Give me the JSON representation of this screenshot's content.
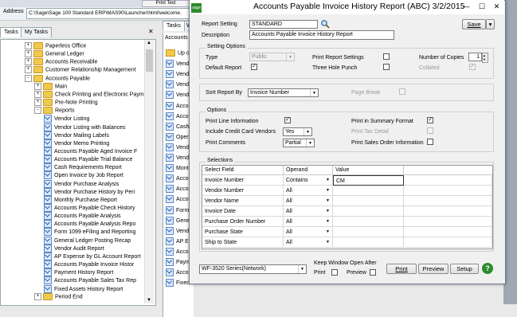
{
  "explorer": {
    "top_tab": "Print Test",
    "address_label": "Address",
    "address_value": "C:\\Sage\\Sage 100 Standard ERP\\MAS90\\Launcher\\html\\welcome.",
    "tabs": [
      "Tasks",
      "My Tasks"
    ],
    "tree": [
      {
        "label": "Paperless Office",
        "indent": 0,
        "exp": "+",
        "type": "folder"
      },
      {
        "label": "General Ledger",
        "indent": 0,
        "exp": "+",
        "type": "folder"
      },
      {
        "label": "Accounts Receivable",
        "indent": 0,
        "exp": "+",
        "type": "folder"
      },
      {
        "label": "Customer Relationship Management",
        "indent": 0,
        "exp": "+",
        "type": "folder"
      },
      {
        "label": "Accounts Payable",
        "indent": 0,
        "exp": "-",
        "type": "folder"
      },
      {
        "label": "Main",
        "indent": 1,
        "exp": "+",
        "type": "folder"
      },
      {
        "label": "Check Printing and Electronic Paymer",
        "indent": 1,
        "exp": "+",
        "type": "folder"
      },
      {
        "label": "Pre-Note Printing",
        "indent": 1,
        "exp": "+",
        "type": "folder"
      },
      {
        "label": "Reports",
        "indent": 1,
        "exp": "-",
        "type": "folder"
      },
      {
        "label": "Vendor Listing",
        "indent": 2,
        "exp": "",
        "type": "task"
      },
      {
        "label": "Vendor Listing with Balances",
        "indent": 2,
        "exp": "",
        "type": "task"
      },
      {
        "label": "Vendor Mailing Labels",
        "indent": 2,
        "exp": "",
        "type": "task"
      },
      {
        "label": "Vendor Memo Printing",
        "indent": 2,
        "exp": "",
        "type": "task"
      },
      {
        "label": "Accounts Payable Aged Invoice F",
        "indent": 2,
        "exp": "",
        "type": "task"
      },
      {
        "label": "Accounts Payable Trial Balance",
        "indent": 2,
        "exp": "",
        "type": "task"
      },
      {
        "label": "Cash Requirements Report",
        "indent": 2,
        "exp": "",
        "type": "task"
      },
      {
        "label": "Open Invoice by Job Report",
        "indent": 2,
        "exp": "",
        "type": "task"
      },
      {
        "label": "Vendor Purchase Analysis",
        "indent": 2,
        "exp": "",
        "type": "task"
      },
      {
        "label": "Vendor Purchase History by Peri",
        "indent": 2,
        "exp": "",
        "type": "task"
      },
      {
        "label": "Monthly Purchase Report",
        "indent": 2,
        "exp": "",
        "type": "task"
      },
      {
        "label": "Accounts Payable Check History",
        "indent": 2,
        "exp": "",
        "type": "task"
      },
      {
        "label": "Accounts Payable Analysis",
        "indent": 2,
        "exp": "",
        "type": "task"
      },
      {
        "label": "Accounts Payable Analysis Repo",
        "indent": 2,
        "exp": "",
        "type": "task"
      },
      {
        "label": "Form 1099 eFiling and Reporting",
        "indent": 2,
        "exp": "",
        "type": "task"
      },
      {
        "label": "General Ledger Posting Recap",
        "indent": 2,
        "exp": "",
        "type": "task"
      },
      {
        "label": "Vendor Audit Report",
        "indent": 2,
        "exp": "",
        "type": "task"
      },
      {
        "label": "AP Expense by GL Account Report",
        "indent": 2,
        "exp": "",
        "type": "task"
      },
      {
        "label": "Accounts Payable Invoice Histor",
        "indent": 2,
        "exp": "",
        "type": "task"
      },
      {
        "label": "Payment History Report",
        "indent": 2,
        "exp": "",
        "type": "task"
      },
      {
        "label": "Accounts Payable Sales Tax Rep",
        "indent": 2,
        "exp": "",
        "type": "task"
      },
      {
        "label": "Fixed Assets History Report",
        "indent": 2,
        "exp": "",
        "type": "task"
      },
      {
        "label": "Period End",
        "indent": 1,
        "exp": "+",
        "type": "folder"
      }
    ],
    "mid_tabs": [
      "Tasks",
      "W"
    ],
    "mid_header": "Accounts",
    "mid_items": [
      "Up one",
      "Vendor",
      "Vendor",
      "Vendor",
      "Vendor",
      "Accoun",
      "Accoun",
      "Cash R",
      "Open I",
      "Vendor",
      "Vendor",
      "Month",
      "Accoun",
      "Accoun",
      "Accoun",
      "Form 1",
      "Genera",
      "Vendor",
      "AP Exp",
      "Accoun",
      "Payme",
      "Accoun",
      "Fixed"
    ]
  },
  "dialog": {
    "title": "Accounts Payable Invoice History Report (ABC) 3/2/2015",
    "report_setting_label": "Report Setting",
    "report_setting_value": "STANDARD",
    "description_label": "Description",
    "description_value": "Accounts Payable Invoice History Report",
    "save_label": "Save",
    "setting_options_label": "Setting Options",
    "type_label": "Type",
    "type_value": "Public",
    "default_report_label": "Default Report",
    "print_report_settings_label": "Print Report Settings",
    "three_hole_punch_label": "Three Hole Punch",
    "number_of_copies_label": "Number of Copies",
    "number_of_copies_value": "1",
    "collated_label": "Collated",
    "sort_report_by_label": "Sort Report By",
    "sort_report_by_value": "Invoice Number",
    "page_break_label": "Page Break",
    "options_label": "Options",
    "print_line_information_label": "Print Line Information",
    "include_cc_vendors_label": "Include Credit Card Vendors",
    "include_cc_vendors_value": "Yes",
    "print_comments_label": "Print Comments",
    "print_comments_value": "Partial",
    "print_in_summary_format_label": "Print in Summary Format",
    "print_tax_detail_label": "Print Tax Detail",
    "print_sales_order_info_label": "Print Sales Order Information",
    "selections_label": "Selections",
    "grid_headers": {
      "field": "Select Field",
      "operand": "Operand",
      "value": "Value"
    },
    "grid_rows": [
      {
        "field": "Invoice Number",
        "operand": "Contains",
        "value": "CM"
      },
      {
        "field": "Vendor Number",
        "operand": "All",
        "value": ""
      },
      {
        "field": "Vendor Name",
        "operand": "All",
        "value": ""
      },
      {
        "field": "Invoice Date",
        "operand": "All",
        "value": ""
      },
      {
        "field": "Purchase Order Number",
        "operand": "All",
        "value": ""
      },
      {
        "field": "Purchase State",
        "operand": "All",
        "value": ""
      },
      {
        "field": "Ship to State",
        "operand": "All",
        "value": ""
      }
    ],
    "printer_value": "WF-3520 Series(Network)",
    "keep_window_open_label": "Keep Window Open After",
    "print_label_small": "Print",
    "preview_label_small": "Preview",
    "print_button": "Print",
    "preview_button": "Preview",
    "setup_button": "Setup",
    "help_icon": "?"
  }
}
